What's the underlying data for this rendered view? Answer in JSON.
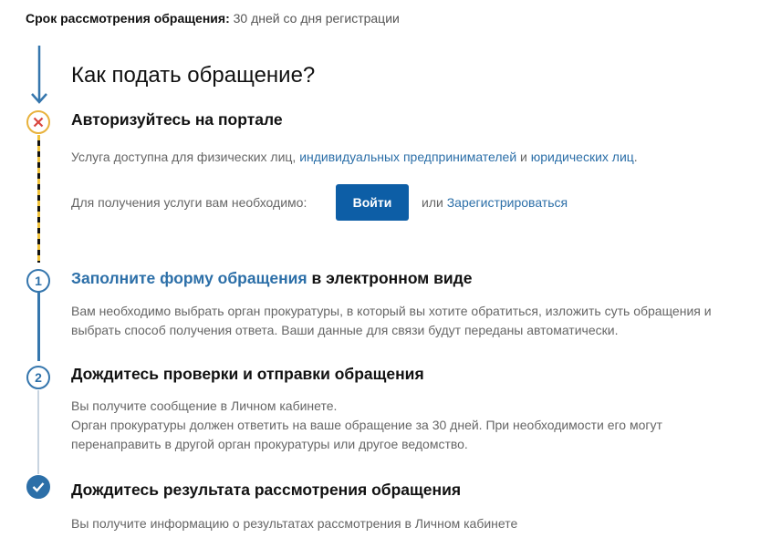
{
  "term": {
    "label": "Срок рассмотрения обращения:",
    "value": "30 дней со дня регистрации"
  },
  "page_title": "Как подать обращение?",
  "steps": {
    "auth": {
      "title": "Авторизуйтесь на портале",
      "service_text_1": "Услуга доступна для физических лиц, ",
      "link_ip": "индивидуальных предпринимателей",
      "service_text_2": " и ",
      "link_legal": "юридических лиц",
      "service_text_3": ".",
      "need_text": "Для получения услуги вам необходимо:",
      "login_label": "Войти",
      "or_text": "или",
      "register_label": "Зарегистрироваться"
    },
    "step1": {
      "number": "1",
      "title_link": "Заполните форму обращения",
      "title_rest": " в электронном виде",
      "text_line1": "Вам необходимо выбрать орган прокуратуры, в который вы хотите обратиться, изложить суть обращения и",
      "text_line2": "выбрать способ получения ответа. Ваши данные для связи будут переданы автоматически."
    },
    "step2": {
      "number": "2",
      "title": "Дождитесь проверки и отправки обращения",
      "text_line1": "Вы получите сообщение в Личном кабинете.",
      "text_line2": "Орган прокуратуры должен ответить на ваше обращение за 30 дней. При необходимости его могут",
      "text_line3": "перенаправить в другой орган прокуратуры или другое ведомство."
    },
    "step3": {
      "title": "Дождитесь результата рассмотрения обращения",
      "text": "Вы получите информацию о результатах рассмотрения в Личном кабинете"
    }
  },
  "colors": {
    "accent": "#0d5ea6",
    "link": "#2c6fa8",
    "warning": "#e8b23d",
    "error": "#d9463f"
  }
}
